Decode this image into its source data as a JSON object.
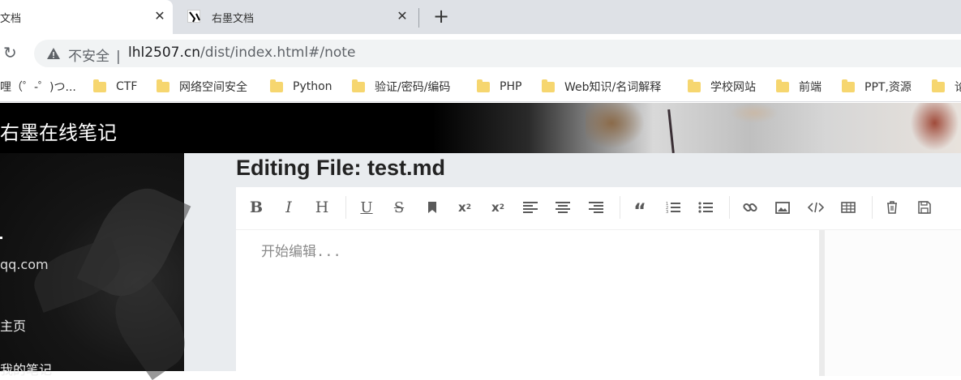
{
  "browser": {
    "tabs": [
      {
        "label": "文档",
        "close": "✕"
      },
      {
        "label": "右墨文档",
        "close": "✕"
      }
    ],
    "new_tab": "+",
    "reload_icon": "↻",
    "security_label": "不安全",
    "url_sep": "|",
    "url_host": "lhl2507.cn",
    "url_path": "/dist/index.html#/note",
    "bookmarks": [
      "哩（゜-゜)つ...",
      "CTF",
      "网络空间安全",
      "Python",
      "验证/密码/编码",
      "PHP",
      "Web知识/名词解释",
      "学校网站",
      "前端",
      "PPT,资源",
      "论"
    ]
  },
  "app": {
    "site_title": "右墨在线笔记",
    "sidebar": {
      "email": "qq.com",
      "items": [
        "主页",
        "我的笔记"
      ]
    },
    "editor": {
      "title": "Editing File: test.md",
      "placeholder": "开始编辑...",
      "toolbar": [
        "bold",
        "italic",
        "heading",
        "underline",
        "strikethrough",
        "mark",
        "superscript",
        "subscript",
        "align-left",
        "align-center",
        "align-right",
        "quote",
        "ordered-list",
        "unordered-list",
        "link",
        "image",
        "code",
        "table",
        "trash",
        "save"
      ]
    }
  }
}
